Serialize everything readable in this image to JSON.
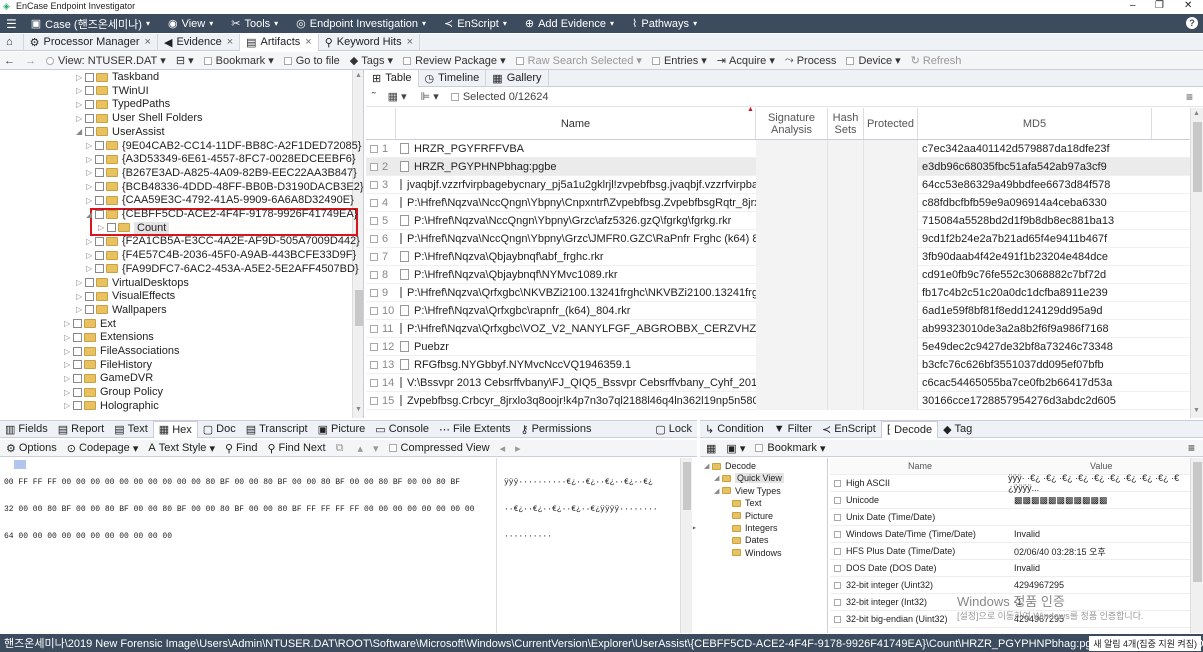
{
  "window": {
    "title": "EnCase Endpoint Investigator",
    "min": "–",
    "max": "❐",
    "close": "✕"
  },
  "appbar": {
    "menu_icon": "☰",
    "items": [
      {
        "icon": "▣",
        "label": "Case (핸즈온세미나)",
        "caret": "▾"
      },
      {
        "icon": "◉",
        "label": "View",
        "caret": "▾"
      },
      {
        "icon": "✂",
        "label": "Tools",
        "caret": "▾"
      },
      {
        "icon": "◎",
        "label": "Endpoint Investigation",
        "caret": "▾"
      },
      {
        "icon": "≺",
        "label": "EnScript",
        "caret": "▾"
      },
      {
        "icon": "⊕",
        "label": "Add Evidence",
        "caret": "▾"
      },
      {
        "icon": "⌇",
        "label": "Pathways",
        "caret": "▾"
      }
    ],
    "help": "?"
  },
  "tabs": [
    {
      "icon": "⌂",
      "label": ""
    },
    {
      "icon": "⚙",
      "label": "Processor Manager",
      "close": "×"
    },
    {
      "icon": "◀",
      "label": "Evidence",
      "close": "×"
    },
    {
      "icon": "▤",
      "label": "Artifacts",
      "close": "×"
    },
    {
      "icon": "⚲",
      "label": "Keyword Hits",
      "close": "×"
    }
  ],
  "toolbar": {
    "back": "←",
    "fwd": "→",
    "view": "View: NTUSER.DAT",
    "view_caret": "▾",
    "split": "⊟",
    "split_caret": "▾",
    "bookmark": "Bookmark",
    "goto": "Go to file",
    "tags": "Tags",
    "review": "Review Package",
    "rawsearch": "Raw Search Selected",
    "entries": "Entries",
    "acquire": "Acquire",
    "process": "Process",
    "device": "Device",
    "refresh": "Refresh"
  },
  "tree": {
    "nodes": [
      {
        "label": "Taskband",
        "depth": 3
      },
      {
        "label": "TWinUI",
        "depth": 3
      },
      {
        "label": "TypedPaths",
        "depth": 3
      },
      {
        "label": "User Shell Folders",
        "depth": 3
      },
      {
        "label": "UserAssist",
        "depth": 3,
        "open": true
      },
      {
        "label": "{9E04CAB2-CC14-11DF-BB8C-A2F1DED72085}",
        "depth": 4
      },
      {
        "label": "{A3D53349-6E61-4557-8FC7-0028EDCEEBF6}",
        "depth": 4
      },
      {
        "label": "{B267E3AD-A825-4A09-82B9-EEC22AA3B847}",
        "depth": 4
      },
      {
        "label": "{BCB48336-4DDD-48FF-BB0B-D3190DACB3E2}",
        "depth": 4
      },
      {
        "label": "{CAA59E3C-4792-41A5-9909-6A6A8D32490E}",
        "depth": 4
      },
      {
        "label": "{CEBFF5CD-ACE2-4F4F-9178-9926F41749EA}",
        "depth": 4,
        "open": true,
        "highlight": true
      },
      {
        "label": "Count",
        "depth": 5,
        "selected": true
      },
      {
        "label": "{F2A1CB5A-E3CC-4A2E-AF9D-505A7009D442}",
        "depth": 4
      },
      {
        "label": "{F4E57C4B-2036-45F0-A9AB-443BCFE33D9F}",
        "depth": 4
      },
      {
        "label": "{FA99DFC7-6AC2-453A-A5E2-5E2AFF4507BD}",
        "depth": 4
      },
      {
        "label": "VirtualDesktops",
        "depth": 3
      },
      {
        "label": "VisualEffects",
        "depth": 3
      },
      {
        "label": "Wallpapers",
        "depth": 3
      },
      {
        "label": "Ext",
        "depth": 2
      },
      {
        "label": "Extensions",
        "depth": 2
      },
      {
        "label": "FileAssociations",
        "depth": 2
      },
      {
        "label": "FileHistory",
        "depth": 2
      },
      {
        "label": "GameDVR",
        "depth": 2
      },
      {
        "label": "Group Policy",
        "depth": 2
      },
      {
        "label": "Holographic",
        "depth": 2
      }
    ]
  },
  "right": {
    "subtabs": [
      {
        "icon": "⊞",
        "label": "Table"
      },
      {
        "icon": "◷",
        "label": "Timeline"
      },
      {
        "icon": "▦",
        "label": "Gallery"
      }
    ],
    "selected": "Selected 0/12624",
    "menu": "≡",
    "columns": [
      "Name",
      "Signature Analysis",
      "Hash Sets",
      "Protected",
      "MD5"
    ],
    "rows": [
      {
        "n": "1",
        "name": "HRZR_PGYFRFFVBA",
        "md5": "c7ec342aa401142d579887da18dfe23f"
      },
      {
        "n": "2",
        "name": "HRZR_PGYPHNPbhag:pgbe",
        "md5": "e3db96c68035fbc51afa542ab97a3cf9"
      },
      {
        "n": "3",
        "name": "jvaqbjf.vzzrfvirpbagebycnary_pj5a1u2gklrjl!zvpebfbsg.jvaqbjf.vzzrfvirpba...",
        "md5": "64cc53e86329a49bbdfee6673d84f578"
      },
      {
        "n": "4",
        "name": "P:\\Hfref\\Nqzva\\NccQngn\\Ybpny\\Cnpxntrf\\Zvpebfbsg.ZvpebfbsgRqtr_8jrxlo3...",
        "md5": "c88fdbcfbfb59e9a096914a4ceba6330"
      },
      {
        "n": "5",
        "name": "P:\\Hfref\\Nqzva\\NccQngn\\Ybpny\\Grzc\\afz5326.gzQ\\fgrkg\\fgrkg.rkr",
        "md5": "715084a5528bd2d1f9b8db8ec881ba13"
      },
      {
        "n": "6",
        "name": "P:\\Hfref\\Nqzva\\NccQngn\\Ybpny\\Grzc\\JMFR0.GZC\\RaPnfr Frghc (k64) 8.04.rkr",
        "md5": "9cd1f2b24e2a7b21ad65f4e9411b467f"
      },
      {
        "n": "7",
        "name": "P:\\Hfref\\Nqzva\\Qbjaybnqf\\abf_frghc.rkr",
        "md5": "3fb90daab4f42e491f1b23204e484dce"
      },
      {
        "n": "8",
        "name": "P:\\Hfref\\Nqzva\\Qbjaybnqf\\NYMvc1089.rkr",
        "md5": "cd91e0fb9c76fe552c3068882c7bf72d"
      },
      {
        "n": "9",
        "name": "P:\\Hfref\\Nqzva\\Qrfxgbc\\NKVBZi2100.13241frghc\\NKVBZi2100.13241frghc....",
        "md5": "fb17c4b2c51c20a0dc1dcfba8911e239"
      },
      {
        "n": "10",
        "name": "P:\\Hfref\\Nqzva\\Qrfxgbc\\rapnfr_(k64)_804.rkr",
        "md5": "6ad1e59f8bf81f8edd124129dd95a9d"
      },
      {
        "n": "11",
        "name": "P:\\Hfref\\Nqzva\\Qrfxgbc\\VOZ_V2_NANYLFGF_ABGROBBX_CERZVHZ_\\v2Vafg...",
        "md5": "ab99323010de3a2a8b2f6f9a986f7168"
      },
      {
        "n": "12",
        "name": "Puebzr",
        "md5": "5e49dec2c9427de32bf8a73246c73348"
      },
      {
        "n": "13",
        "name": "RFGfbsg.NYGbbyf.NYMvcNccVQ1946359.1",
        "md5": "b3cfc76c626bf3551037dd095ef07bfb"
      },
      {
        "n": "14",
        "name": "V:\\Bssvpr 2013 Cebsrffvbany\\FJ_QIQ5_Bssvpr Cebsrffvbany_Cyhf_2013J_FC...",
        "md5": "c6cac54465055ba7ce0fb2b66417d53a"
      },
      {
        "n": "15",
        "name": "Zvpebfbsg.Crbcyr_8jrxlo3q8oojr!k4p7n3o7ql2188l46q4ln362l19np5n5805...",
        "md5": "30166cce1728857954276d3abdc2d605"
      }
    ]
  },
  "bottom_left": {
    "tabs": [
      "Fields",
      "Report",
      "Text",
      "Hex",
      "Doc",
      "Transcript",
      "Picture",
      "Console",
      "File Extents",
      "Permissions",
      "Lock"
    ],
    "tab_icons": [
      "▥",
      "▤",
      "▤",
      "▦",
      "▢",
      "▤",
      "▣",
      "▭",
      "⋯",
      "⚷",
      "▢"
    ],
    "bar": {
      "options": "Options",
      "codepage": "Codepage",
      "textstyle": "Text Style",
      "find": "Find",
      "findnext": "Find Next",
      "compressed": "Compressed View"
    },
    "hex_lines": [
      "00 FF FF FF 00 00 00 00 00 00 00 00 00 00 80 BF 00 00 80 BF 00 00 80 BF 00 00 80 BF 00 00 80 BF",
      "32 00 00 80 BF 00 00 80 BF 00 00 80 BF 00 00 80 BF 00 00 80 BF FF FF FF FF 00 00 00 00 00 00 00 00",
      "64 00 00 00 00 00 00 00 00 00 00 00"
    ],
    "text_lines": [
      "ÿÿÿ··········€¿··€¿··€¿··€¿··€¿",
      "··€¿··€¿··€¿··€¿··€¿ÿÿÿÿ········",
      "··········"
    ]
  },
  "bottom_right": {
    "tabs": [
      "Condition",
      "Filter",
      "EnScript",
      "Decode",
      "Tag"
    ],
    "tab_icons": [
      "↳",
      "▼",
      "≺",
      "⁅",
      "◆"
    ],
    "bookmark": "Bookmark",
    "tree": [
      {
        "label": "Decode",
        "depth": 0
      },
      {
        "label": "Quick View",
        "depth": 1,
        "selected": true
      },
      {
        "label": "View Types",
        "depth": 1
      },
      {
        "label": "Text",
        "depth": 2
      },
      {
        "label": "Picture",
        "depth": 2
      },
      {
        "label": "Integers",
        "depth": 2
      },
      {
        "label": "Dates",
        "depth": 2
      },
      {
        "label": "Windows",
        "depth": 2
      }
    ],
    "cols": [
      "Name",
      "Value"
    ],
    "rows": [
      {
        "name": "High ASCII",
        "value": "ÿÿÿ· ·€¿ ·€¿ ·€¿ ·€¿ ·€¿ ·€¿ ·€¿ ·€¿ ·€¿ ·€¿ÿÿÿÿ..."
      },
      {
        "name": "Unicode",
        "value": "▩▩▩▩▩▩▩▩▩▩▩"
      },
      {
        "name": "Unix Date (Time/Date)",
        "value": ""
      },
      {
        "name": "Windows Date/Time (Time/Date)",
        "value": "Invalid"
      },
      {
        "name": "HFS Plus Date (Time/Date)",
        "value": "02/06/40 03:28:15 오후"
      },
      {
        "name": "DOS Date (DOS Date)",
        "value": "Invalid"
      },
      {
        "name": "32-bit integer (Uint32)",
        "value": "4294967295"
      },
      {
        "name": "32-bit integer (Int32)",
        "value": "-1"
      },
      {
        "name": "32-bit big-endian (Uint32)",
        "value": "4294967295"
      }
    ],
    "watermark1": "Windows 정품 인증",
    "watermark2": "[설정]으로 이동하여 Windows를 정품 인증합니다."
  },
  "status": {
    "text": "핸즈온세미나\\2019 New Forensic Image\\Users\\Admin\\NTUSER.DAT\\ROOT\\Software\\Microsoft\\Windows\\CurrentVersion\\Explorer\\UserAssist\\{CEBFF5CD-ACE2-4F4F-9178-9926F41749EA}\\Count\\HRZR_PGYPHNPbhag:pgbe (PS 806 CL 806 SO 236 FO 0 LE 1)",
    "notify": "새 알림 4개(집중 지원 켜짐)"
  }
}
